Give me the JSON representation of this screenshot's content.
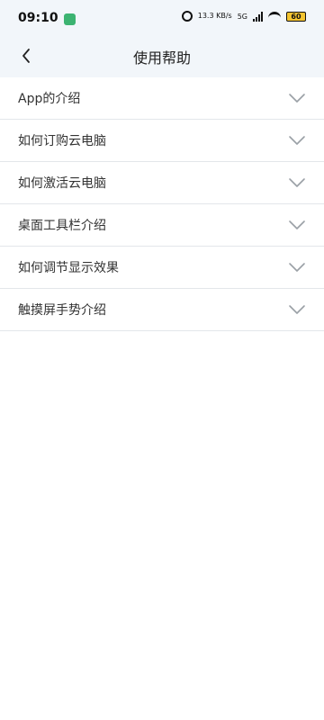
{
  "status_bar": {
    "time": "09:10",
    "network_speed": "13.3 KB/s",
    "network_type": "5G",
    "battery": "60",
    "icons": [
      "app-notification-icon",
      "alarm-icon",
      "signal-icon",
      "wifi-icon",
      "battery-icon"
    ]
  },
  "header": {
    "title": "使用帮助",
    "back_icon": "chevron-left-icon"
  },
  "help_items": [
    {
      "label": "App的介绍"
    },
    {
      "label": "如何订购云电脑"
    },
    {
      "label": "如何激活云电脑"
    },
    {
      "label": "桌面工具栏介绍"
    },
    {
      "label": "如何调节显示效果"
    },
    {
      "label": "触摸屏手势介绍"
    }
  ],
  "colors": {
    "header_bg": "#f2f6fa",
    "divider": "#e3e6ea",
    "text": "#333333",
    "chevron": "#9aa0a6"
  }
}
